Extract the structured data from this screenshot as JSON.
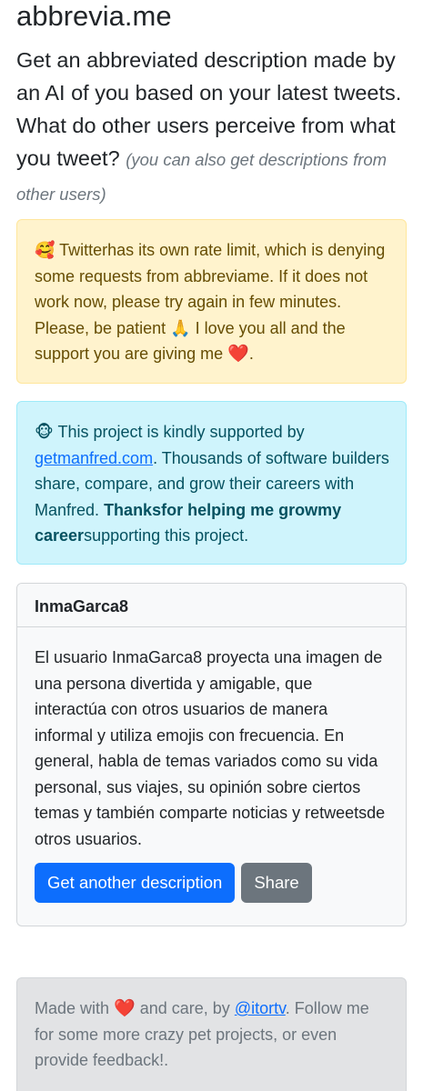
{
  "header": {
    "site_title": "abbrevia.me",
    "lead_text": "Get an abbreviated description made by an AI of you based on your latest tweets. What do other users perceive from what you tweet?",
    "lead_hint": "(you can also get descriptions from other users)"
  },
  "warning_alert": {
    "emoji": "🥰",
    "text": "Twitterhas its own rate limit, which is denying some requests from abbreviame. If it does not work now, please try again in few minutes. Please, be patient",
    "pray_emoji": "🙏",
    "text_after": "I love you all and the support you are giving me",
    "heart": "❤️",
    "end": "."
  },
  "info_alert": {
    "emoji": "🐵",
    "text_before": "This project is kindly supported by",
    "link_text": "getmanfred.com",
    "text_middle": ". Thousands of software builders share, compare, and grow their careers with Manfred.",
    "bold_text": "Thanksfor helping me growmy career",
    "text_after": "supporting this project."
  },
  "result_card": {
    "username": "InmaGarca8",
    "description": "El usuario InmaGarca8 proyecta una imagen de una persona divertida y amigable, que interactúa con otros usuarios de manera informal y utiliza emojis con frecuencia. En general, habla de temas variados como su vida personal, sus viajes, su opinión sobre ciertos temas y también comparte noticias y retweetsde otros usuarios.",
    "primary_button_label": "Get another description",
    "share_button_label": "Share"
  },
  "footer": {
    "text_before": "Made with",
    "heart": "❤️",
    "text_middle": "and care, by",
    "link_text": "@itortv",
    "text_after": ". Follow me for some more crazy pet projects, or even provide feedback!."
  },
  "colors": {
    "primary": "#0d6efd",
    "secondary": "#6c757d",
    "warning_bg": "#fff3cd",
    "info_bg": "#cff4fc",
    "footer_bg": "#e2e3e5"
  }
}
